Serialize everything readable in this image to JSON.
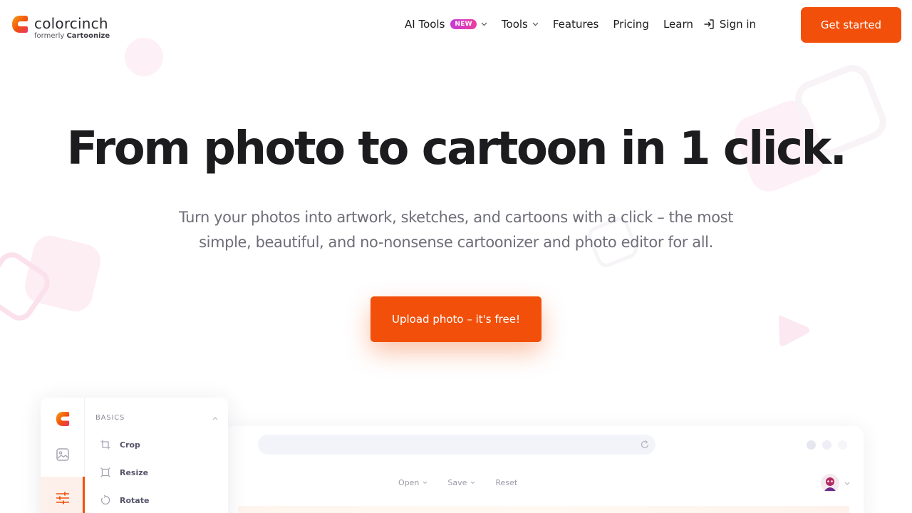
{
  "brand": {
    "name": "colorcinch",
    "formerly_prefix": "formerly",
    "formerly_name": "Cartoonize",
    "accent": "#f2500a"
  },
  "nav": {
    "ai_tools": "AI Tools",
    "ai_badge": "NEW",
    "tools": "Tools",
    "features": "Features",
    "pricing": "Pricing",
    "learn": "Learn",
    "sign_in": "Sign in",
    "get_started": "Get started"
  },
  "hero": {
    "title": "From photo to cartoon in 1 click.",
    "subtitle_line1": "Turn your photos into artwork, sketches, and cartoons with a click – the most",
    "subtitle_line2": "simple, beautiful, and no-nonsense cartoonizer and photo editor for all.",
    "cta": "Upload photo – it's free!"
  },
  "editor": {
    "section": "BASICS",
    "tools": [
      "Crop",
      "Resize",
      "Rotate"
    ],
    "toolbar": [
      "Open",
      "Save",
      "Reset"
    ],
    "icons": [
      "logo-icon",
      "image-icon",
      "sliders-icon",
      "crop-icon",
      "resize-icon",
      "rotate-icon",
      "reload-icon"
    ]
  }
}
